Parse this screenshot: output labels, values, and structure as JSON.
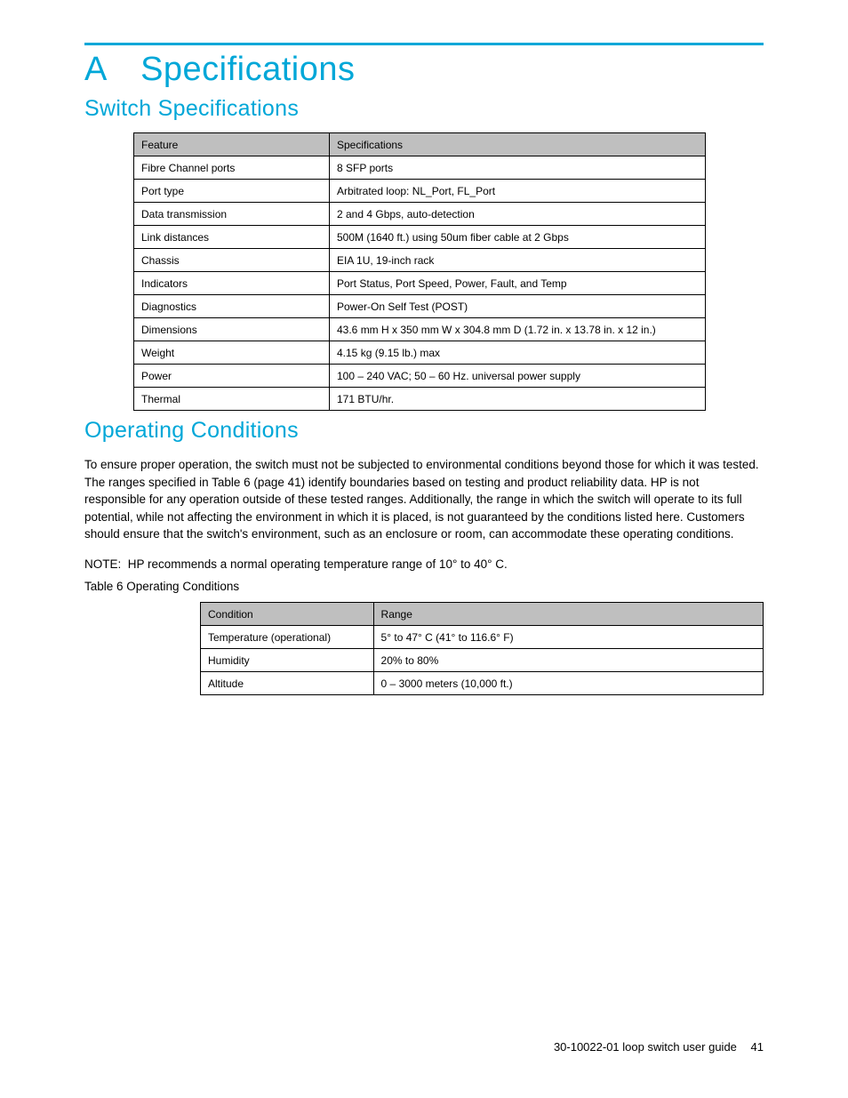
{
  "appendix_label": "A",
  "appendix_title": "Specifications",
  "section1": {
    "title": "Switch Specifications",
    "table": {
      "header": [
        "Feature",
        "Specifications"
      ],
      "rows": [
        [
          "Fibre Channel ports",
          "8 SFP ports"
        ],
        [
          "Port type",
          "Arbitrated loop: NL_Port, FL_Port"
        ],
        [
          "Data transmission",
          "2 and 4 Gbps, auto-detection"
        ],
        [
          "Link distances",
          "500M (1640 ft.) using 50um fiber cable at 2 Gbps"
        ],
        [
          "Chassis",
          "EIA 1U, 19-inch rack"
        ],
        [
          "Indicators",
          "Port Status, Port Speed, Power, Fault, and Temp"
        ],
        [
          "Diagnostics",
          "Power-On Self Test (POST)"
        ],
        [
          "Dimensions",
          "43.6 mm H x 350 mm W x 304.8 mm D (1.72 in. x 13.78 in. x 12 in.)"
        ],
        [
          "Weight",
          "4.15 kg (9.15 lb.) max"
        ],
        [
          "Power",
          "100 – 240 VAC; 50 – 60 Hz. universal power supply"
        ],
        [
          "Thermal",
          "171 BTU/hr."
        ]
      ]
    }
  },
  "section2": {
    "title": "Operating Conditions",
    "para1": "To ensure proper operation, the switch must not be subjected to environmental conditions beyond those for which it was tested. The ranges specified in Table 6 (page 41) identify boundaries based on testing and product reliability data. HP is not responsible for any operation outside of these tested ranges. Additionally, the range in which the switch will operate to its full potential, while not affecting the environment in which it is placed, is not guaranteed by the conditions listed here. Customers should ensure that the switch's environment, such as an enclosure or room, can accommodate these operating conditions.",
    "note": "NOTE:  HP recommends a normal operating temperature range of 10° to 40° C.",
    "caption": "Table 6 Operating Conditions",
    "table": {
      "header": [
        "Condition",
        "Range"
      ],
      "rows": [
        [
          "Temperature (operational)",
          "5° to 47° C (41° to 116.6° F)"
        ],
        [
          "Humidity",
          "20% to 80%"
        ],
        [
          "Altitude",
          "0 – 3000 meters (10,000 ft.)"
        ]
      ]
    }
  },
  "footer": {
    "doc": "30-10022-01 loop switch user guide",
    "page": "41"
  }
}
